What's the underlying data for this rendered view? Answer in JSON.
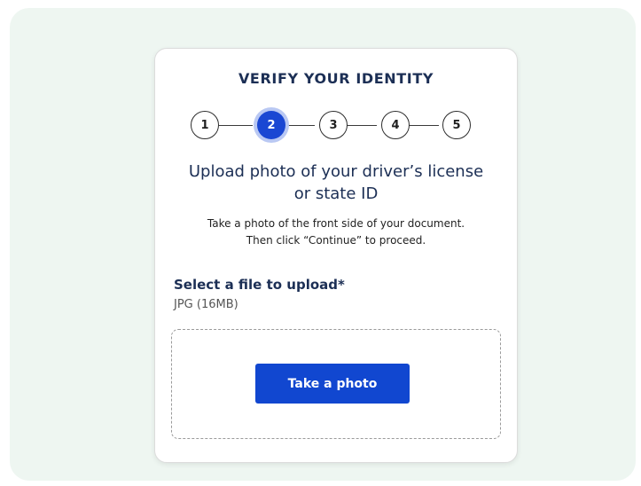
{
  "card": {
    "title": "VERIFY YOUR IDENTITY",
    "steps": [
      {
        "label": "1",
        "active": false
      },
      {
        "label": "2",
        "active": true
      },
      {
        "label": "3",
        "active": false
      },
      {
        "label": "4",
        "active": false
      },
      {
        "label": "5",
        "active": false
      }
    ],
    "heading_line1": "Upload photo of your driver’s license",
    "heading_line2": "or state ID",
    "instructions_line1": "Take a photo of the front side of your document.",
    "instructions_line2": "Then click “Continue” to proceed.",
    "select_label": "Select a file to upload*",
    "file_hint": "JPG (16MB)",
    "button_label": "Take a photo"
  },
  "colors": {
    "background": "#eef6f1",
    "title_text": "#1c2f55",
    "active_step": "#1a47d3",
    "active_step_ring": "#b9c8f3",
    "button": "#1147d0"
  }
}
